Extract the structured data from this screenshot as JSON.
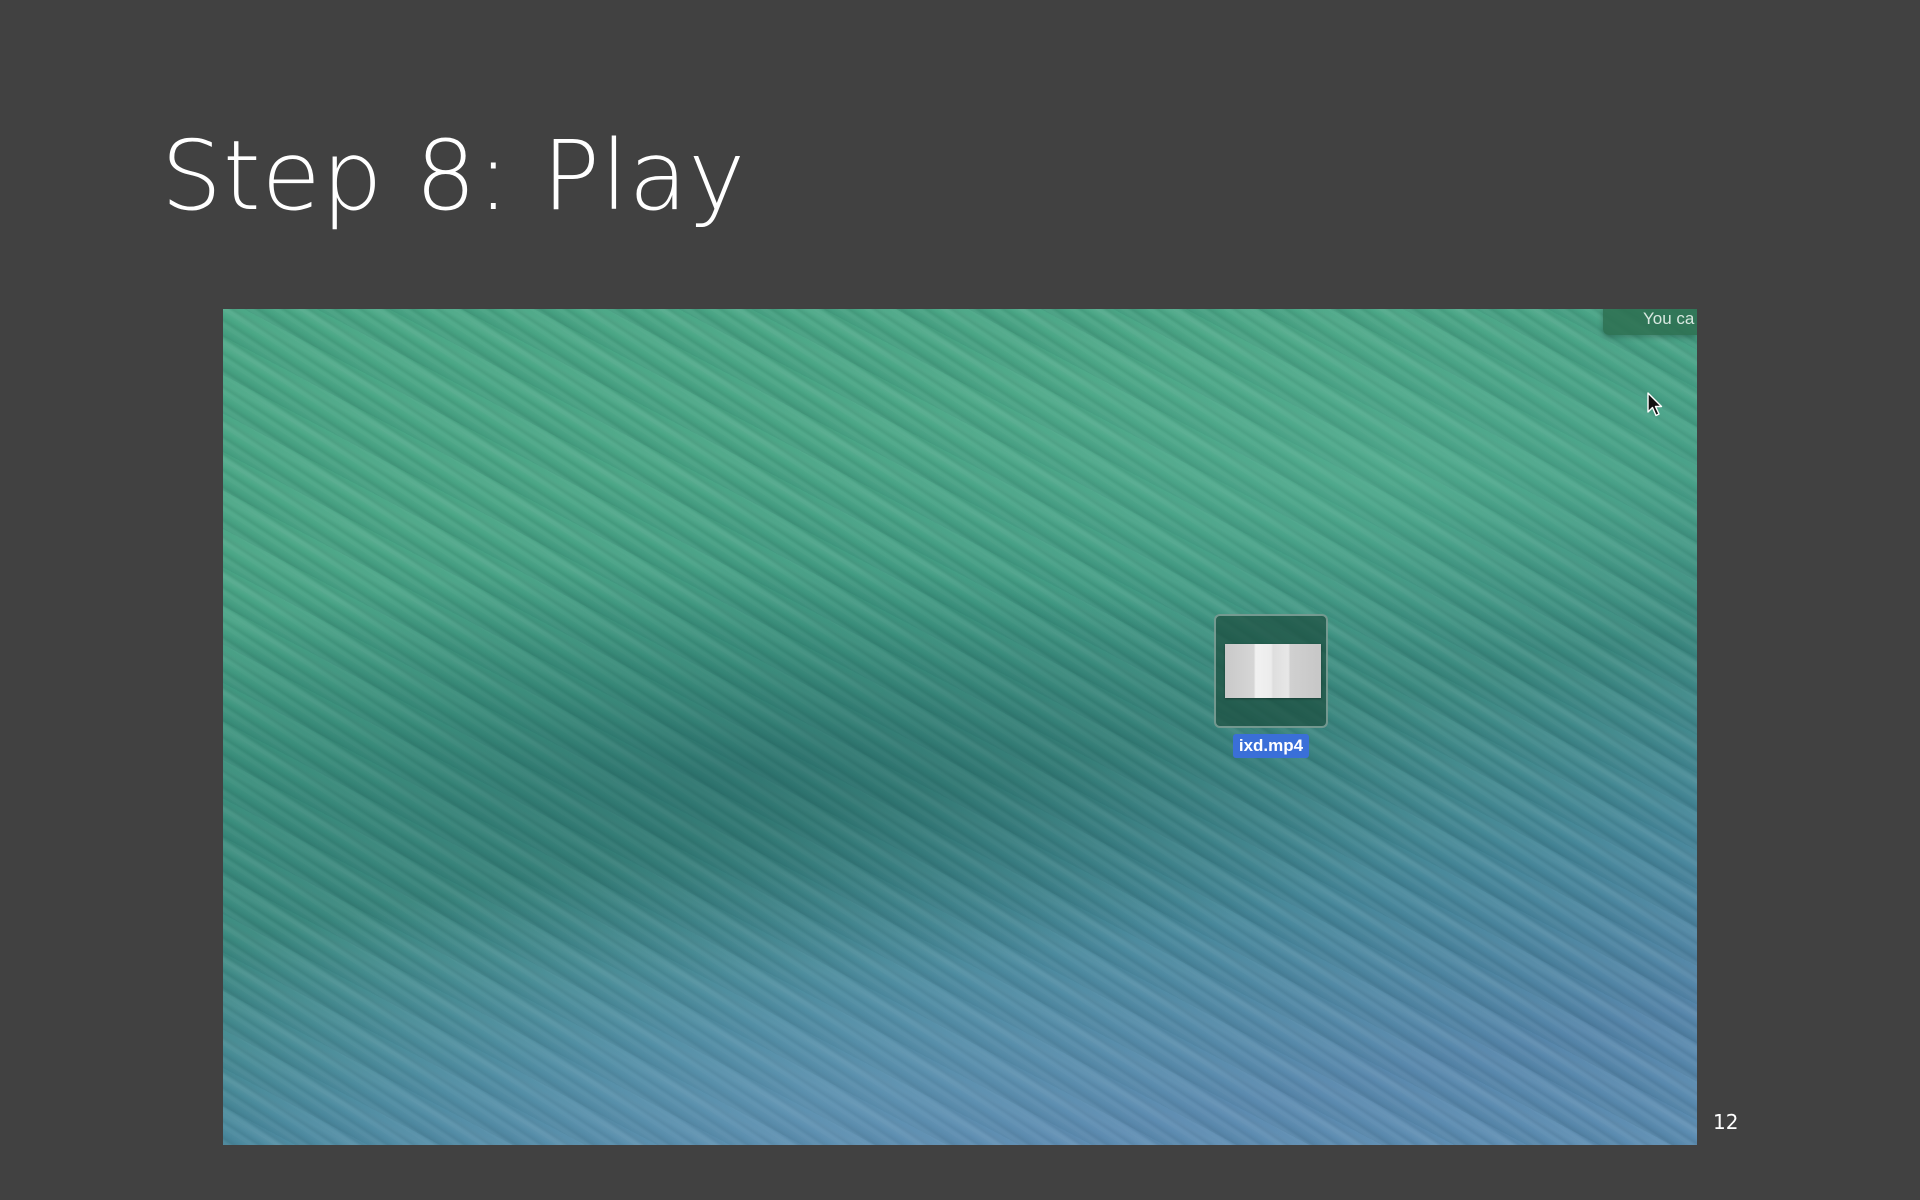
{
  "slide": {
    "title": "Step 8: Play",
    "page_number": "12"
  },
  "desktop": {
    "notification_text": "You ca",
    "file": {
      "name": "ixd.mp4",
      "icon": "video-file-icon",
      "selected": true
    },
    "cursor_icon": "mouse-pointer-icon"
  },
  "colors": {
    "slide_background": "#414141",
    "title_text": "#ffffff",
    "selection_label": "#3a6fd8",
    "wallpaper_green": "#49a785",
    "wallpaper_blue": "#5c8db2"
  }
}
